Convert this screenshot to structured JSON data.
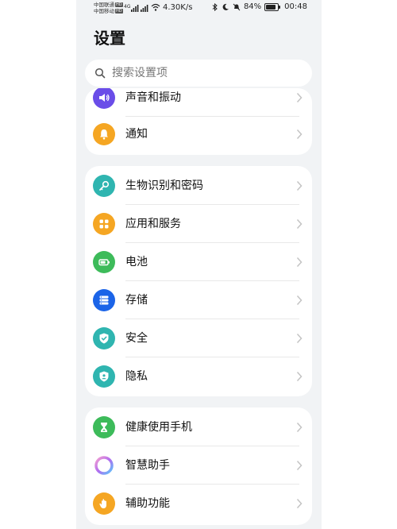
{
  "status_bar": {
    "carrier1": "中国联通",
    "carrier2": "中国移动",
    "hd": "HD",
    "signal_label": "4G",
    "net_speed": "4.30K/s",
    "battery_percent": "84%",
    "battery_level": 0.84,
    "time": "00:48"
  },
  "page_title": "设置",
  "search": {
    "placeholder": "搜索设置项"
  },
  "groups": [
    {
      "items": [
        {
          "label": "声音和振动",
          "icon": "speaker-icon",
          "color": "#6a4de8"
        },
        {
          "label": "通知",
          "icon": "bell-icon",
          "color": "#f5a623"
        }
      ]
    },
    {
      "items": [
        {
          "label": "生物识别和密码",
          "icon": "key-icon",
          "color": "#2fb5b0"
        },
        {
          "label": "应用和服务",
          "icon": "apps-grid-icon",
          "color": "#f5a623"
        },
        {
          "label": "电池",
          "icon": "battery-icon",
          "color": "#3dbb5a"
        },
        {
          "label": "存储",
          "icon": "storage-icon",
          "color": "#1b64e8"
        },
        {
          "label": "安全",
          "icon": "shield-check-icon",
          "color": "#2fb5b0"
        },
        {
          "label": "隐私",
          "icon": "privacy-shield-icon",
          "color": "#2fb5b0"
        }
      ]
    },
    {
      "items": [
        {
          "label": "健康使用手机",
          "icon": "hourglass-icon",
          "color": "#3dbb5a"
        },
        {
          "label": "智慧助手",
          "icon": "assistant-ring-icon",
          "color": "#b06cf0"
        },
        {
          "label": "辅助功能",
          "icon": "hand-icon",
          "color": "#f5a623"
        }
      ]
    }
  ]
}
